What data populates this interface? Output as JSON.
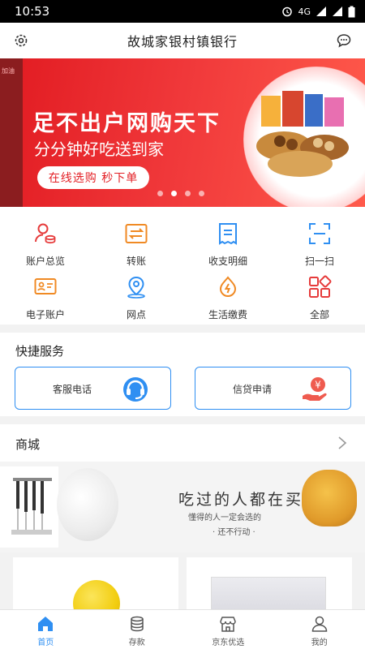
{
  "status_bar": {
    "time": "10:53",
    "network": "4G"
  },
  "header": {
    "title": "故城家银村镇银行",
    "settings_icon": "gear-icon",
    "message_icon": "chat-bubble-icon"
  },
  "banner": {
    "side_text": "加油",
    "headline": "足不出户网购天下",
    "subline": "分分钟好吃送到家",
    "cta": "在线选购 秒下单",
    "slide_count": 4,
    "active_slide": 1
  },
  "functions": [
    {
      "label": "账户总览",
      "icon": "account-overview-icon"
    },
    {
      "label": "转账",
      "icon": "transfer-icon"
    },
    {
      "label": "收支明细",
      "icon": "statement-icon"
    },
    {
      "label": "扫一扫",
      "icon": "scan-icon"
    },
    {
      "label": "电子账户",
      "icon": "e-account-icon"
    },
    {
      "label": "网点",
      "icon": "location-icon"
    },
    {
      "label": "生活缴费",
      "icon": "bill-payment-icon"
    },
    {
      "label": "全部",
      "icon": "all-apps-icon"
    }
  ],
  "quick_services": {
    "title": "快捷服务",
    "items": [
      {
        "label": "客服电话",
        "icon": "customer-service-headset-icon"
      },
      {
        "label": "信贷申请",
        "icon": "loan-application-icon"
      }
    ]
  },
  "mall": {
    "title": "商城",
    "promo_title": "吃过的人都在买",
    "promo_sub": "懂得的人一定会选的",
    "promo_sub2": "· 还不行动 ·"
  },
  "tabbar": [
    {
      "label": "首页",
      "icon": "home-icon",
      "active": true
    },
    {
      "label": "存款",
      "icon": "coins-icon",
      "active": false
    },
    {
      "label": "京东优选",
      "icon": "shop-icon",
      "active": false
    },
    {
      "label": "我的",
      "icon": "user-icon",
      "active": false
    }
  ],
  "colors": {
    "brand_blue": "#2f8ff2",
    "banner_red": "#e31e24",
    "icon_orange": "#f08a24"
  }
}
